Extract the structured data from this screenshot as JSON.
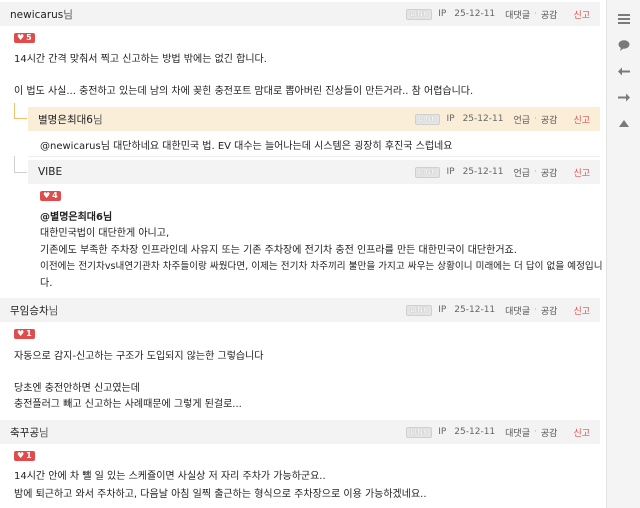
{
  "ui": {
    "link_label": "LINK",
    "ip_label": "IP",
    "reply_label": "대댓글",
    "mention_label": "언급",
    "like_label": "공감",
    "report_label": "신고",
    "suffix": "님",
    "accent": "#e04b4b"
  },
  "sidebar": {
    "icons": [
      "list-icon",
      "comment-icon",
      "arrow-left-icon",
      "arrow-right-icon",
      "arrow-up-icon"
    ]
  },
  "comments": [
    {
      "nick": "newicarus",
      "date": "25-12-11",
      "likes": "5",
      "lines": [
        "14시간 간격 맞춰서 찍고 신고하는 방법 밖에는 없긴 합니다.",
        "이 법도 사실... 충전하고 있는데 남의 차에 꽂힌 충전포트 맘대로 뽑아버린 진상들이 만든거라.. 참 어렵습니다."
      ]
    },
    {
      "nick": "별명은최대6",
      "date": "25-12-11",
      "lines": [
        "@newicarus님 대단하네요 대한민국 법. EV 대수는 늘어나는데 시스템은 굉장히 후진국 스럽네요"
      ]
    },
    {
      "nick": "VIBE",
      "date": "25-12-11",
      "likes": "4",
      "mention": "@별명은최대6님",
      "lines": [
        "대한민국법이 대단한게 아니고,",
        "기존에도 부족한 주차장 인프라인데 사유지 또는 기존 주차장에 전기차 충전 인프라를 만든 대한민국이 대단한거죠.",
        "이전에는 전기차vs내연기관차 차주들이랑 싸웠다면, 이제는 전기차 차주끼리 불만을 가지고 싸우는 상황이니 미래에는 더 답이 없을 예정입니",
        "다."
      ]
    },
    {
      "nick": "무임승차",
      "date": "25-12-11",
      "likes": "1",
      "lines": [
        "자동으로 감지-신고하는 구조가 도입되지 않는한 그렇습니다",
        "당초엔 충전안하면 신고였는데",
        "충전플러그 빼고 신고하는 사례때문에 그렇게 된걸로..."
      ]
    },
    {
      "nick": "축꾸공",
      "date": "25-12-11",
      "likes": "1",
      "lines": [
        "14시간 안에 차 뺄 일 있는 스케쥴이면 사실상 저 자리 주차가 가능하군요..",
        "밤에 퇴근하고 와서 주차하고, 다음날 아침 일찍 출근하는 형식으로 주차장으로 이용 가능하겠네요.."
      ]
    }
  ]
}
